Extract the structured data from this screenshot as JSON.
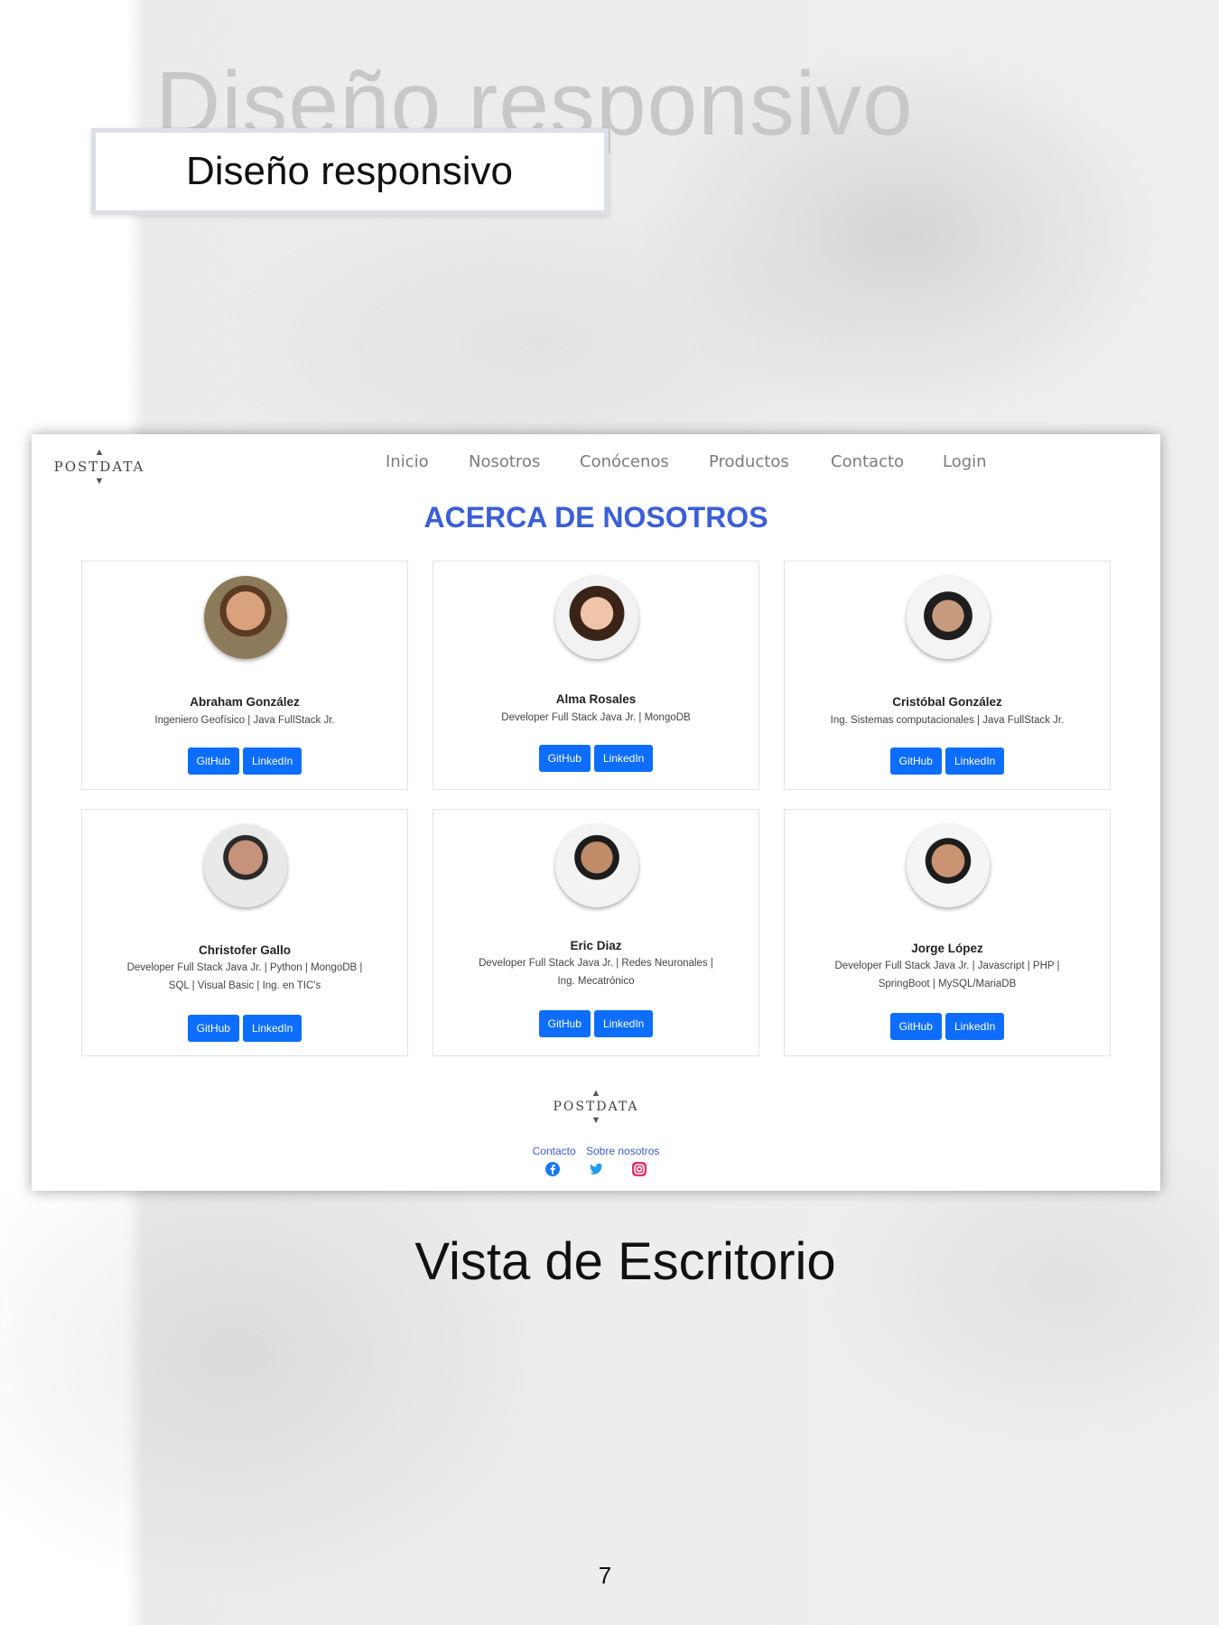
{
  "slide": {
    "ghost_title": "Diseño responsivo",
    "title": "Diseño responsivo",
    "caption": "Vista de Escritorio",
    "page_number": "7"
  },
  "site": {
    "logo_text": "POSTDATA",
    "nav": [
      "Inicio",
      "Nosotros",
      "Conócenos",
      "Productos",
      "Contacto",
      "Login"
    ],
    "heading": "ACERCA DE NOSOTROS",
    "accent_color": "#3b5fd6",
    "button_color": "#0d6efd",
    "members": [
      {
        "name": "Abraham González",
        "desc": [
          "Ingeniero Geofísico | Java FullStack Jr."
        ],
        "buttons": [
          "GitHub",
          "LinkedIn"
        ]
      },
      {
        "name": "Alma Rosales",
        "desc": [
          "Developer Full Stack Java Jr. | MongoDB"
        ],
        "buttons": [
          "GitHub",
          "LinkedIn"
        ]
      },
      {
        "name": "Cristóbal González",
        "desc": [
          "Ing. Sistemas computacionales | Java FullStack Jr."
        ],
        "buttons": [
          "GitHub",
          "LinkedIn"
        ]
      },
      {
        "name": "Christofer Gallo",
        "desc": [
          "Developer Full Stack Java Jr. | Python | MongoDB |",
          "SQL | Visual Basic | Ing. en TIC's"
        ],
        "buttons": [
          "GitHub",
          "LinkedIn"
        ]
      },
      {
        "name": "Eric Diaz",
        "desc": [
          "Developer Full Stack Java Jr. | Redes Neuronales |",
          "Ing. Mecatrónico"
        ],
        "buttons": [
          "GitHub",
          "LinkedIn"
        ]
      },
      {
        "name": "Jorge López",
        "desc": [
          "Developer Full Stack Java Jr. | Javascript | PHP |",
          "SpringBoot | MySQL/MariaDB"
        ],
        "buttons": [
          "GitHub",
          "LinkedIn"
        ]
      }
    ],
    "footer": {
      "logo_text": "POSTDATA",
      "links": [
        "Contacto",
        "Sobre nosotros"
      ],
      "social_icons": [
        "facebook-icon",
        "twitter-icon",
        "instagram-icon"
      ]
    }
  }
}
